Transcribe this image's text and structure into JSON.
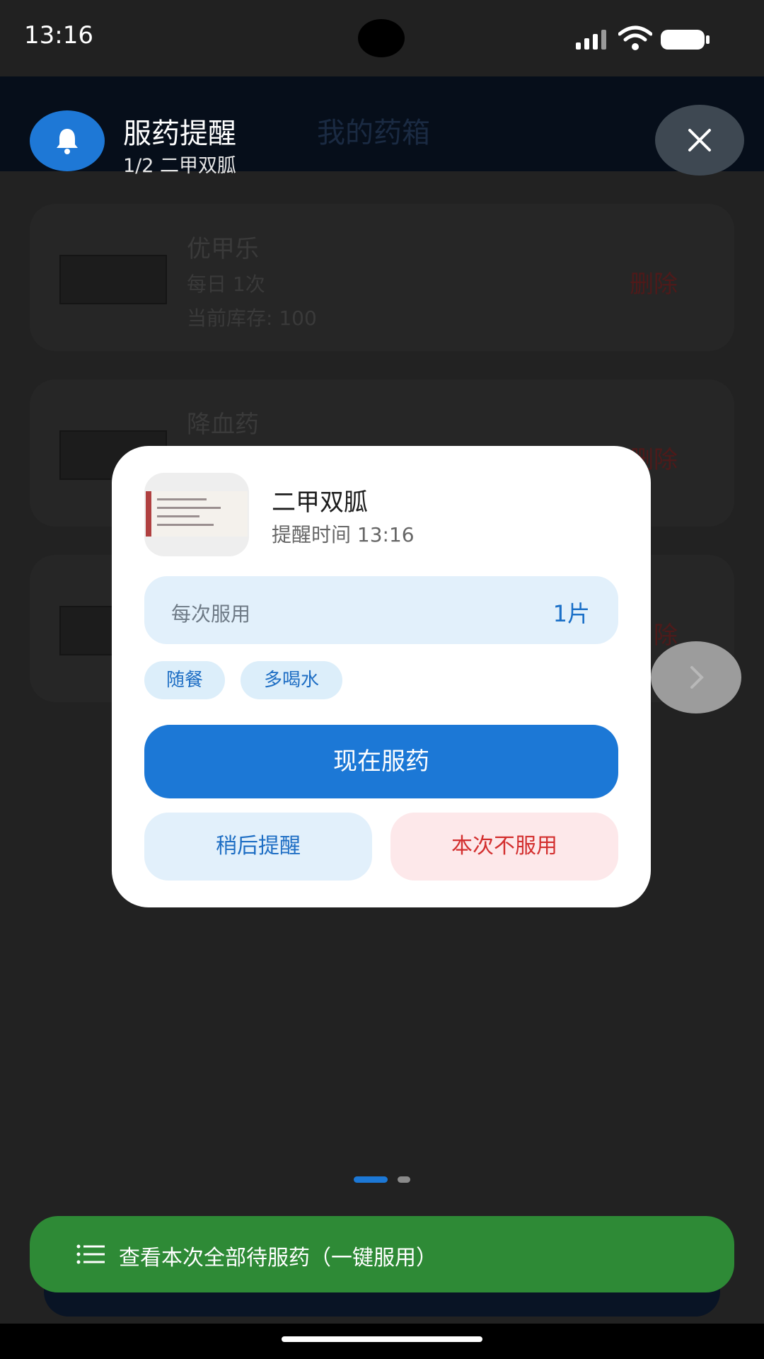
{
  "status_bar": {
    "time": "13:16"
  },
  "header": {
    "tab_label": "我的药箱"
  },
  "medicine_list": [
    {
      "name": "优甲乐",
      "frequency": "每日 1次",
      "stock": "当前库存: 100",
      "delete_label": "删除"
    },
    {
      "name": "降血药",
      "frequency": "",
      "stock": "",
      "delete_label": "删除"
    },
    {
      "name": "",
      "frequency": "",
      "stock": "",
      "delete_label": "除"
    }
  ],
  "reminder_banner": {
    "title": "服药提醒",
    "subtitle": "1/2 二甲双胍",
    "bell_icon": "bell-icon",
    "close_icon": "close-icon"
  },
  "dialog": {
    "medicine_name": "二甲双胍",
    "remind_time": "提醒时间 13:16",
    "dose_label": "每次服用",
    "dose_value": "1片",
    "tags": [
      "随餐",
      "多喝水"
    ],
    "take_now": "现在服药",
    "remind_later": "稍后提醒",
    "skip": "本次不服用"
  },
  "pager": {
    "current": 1,
    "total": 2
  },
  "bottom_action": {
    "label": "查看本次全部待服药（一键服用）",
    "icon": "list-icon"
  },
  "colors": {
    "primary": "#1c78d6",
    "success": "#2e8a36",
    "danger": "#d32f2f",
    "dose_bg": "#e2f0fb"
  }
}
